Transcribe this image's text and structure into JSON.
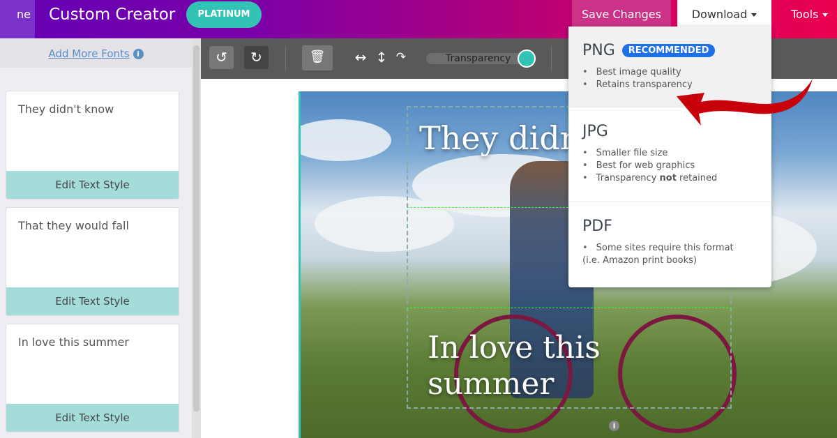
{
  "header": {
    "home_label": "ne",
    "title": "Custom Creator",
    "badge": "PLATINUM",
    "save_label": "Save Changes",
    "download_label": "Download",
    "tools_label": "Tools"
  },
  "sidebar": {
    "add_fonts_label": "Add More Fonts",
    "cards": [
      {
        "text": "They didn't know",
        "button": "Edit Text Style"
      },
      {
        "text": "That they would fall",
        "button": "Edit Text Style"
      },
      {
        "text": "In love this summer",
        "button": "Edit Text Style"
      }
    ]
  },
  "toolbar": {
    "transparency_label": "Transparency"
  },
  "canvas": {
    "text1": "They didn't",
    "text2_line1": "In love this",
    "text2_line2": "summer"
  },
  "download_menu": {
    "options": [
      {
        "format": "PNG",
        "badge": "RECOMMENDED",
        "bullets": [
          "Best image quality",
          "Retains transparency"
        ]
      },
      {
        "format": "JPG",
        "bullets": [
          "Smaller file size",
          "Best for web graphics"
        ],
        "bullet3_pre": "Transparency ",
        "bullet3_bold": "not",
        "bullet3_post": " retained"
      },
      {
        "format": "PDF",
        "bullets": [
          "Some sites require this format"
        ],
        "note": "(i.e. Amazon print books)"
      }
    ]
  },
  "colors": {
    "accent": "#33c3b5",
    "recommended": "#1f6fe6",
    "arrow": "#c8000a"
  }
}
